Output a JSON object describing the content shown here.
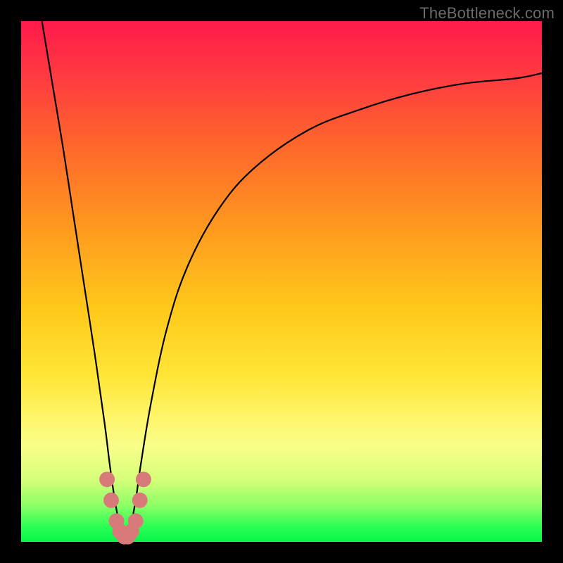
{
  "watermark": "TheBottleneck.com",
  "chart_data": {
    "type": "line",
    "title": "",
    "xlabel": "",
    "ylabel": "",
    "xlim": [
      0,
      100
    ],
    "ylim": [
      0,
      100
    ],
    "series": [
      {
        "name": "bottleneck-curve",
        "x": [
          4,
          6,
          8,
          10,
          12,
          14,
          16,
          17,
          18,
          19,
          20,
          21,
          22,
          23,
          25,
          28,
          32,
          38,
          45,
          55,
          65,
          75,
          85,
          95,
          100
        ],
        "y": [
          100,
          88,
          76,
          63,
          50,
          37,
          23,
          15,
          8,
          3,
          1,
          3,
          8,
          15,
          27,
          41,
          53,
          64,
          72,
          79,
          83,
          86,
          88,
          89,
          90
        ],
        "stroke": "#000000"
      }
    ],
    "valley_markers": {
      "color": "#d97a7a",
      "points_x": [
        16.5,
        17.3,
        18.3,
        19.0,
        19.8,
        20.5,
        21.2,
        22.0,
        22.8,
        23.5
      ],
      "points_y": [
        12,
        8,
        4,
        2,
        1,
        1,
        2,
        4,
        8,
        12
      ],
      "radius_px": 11
    }
  },
  "colors": {
    "background": "#000000",
    "gradient_top": "#ff1a4b",
    "gradient_bottom": "#06f54a",
    "curve": "#000000",
    "marker": "#d97a7a",
    "watermark": "#6b6b6b"
  }
}
